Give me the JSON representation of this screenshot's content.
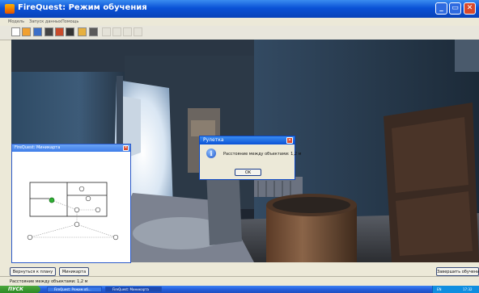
{
  "window": {
    "title": "FireQuest: Режим обучения",
    "minimize_symbol": "_",
    "maximize_symbol": "▭",
    "close_symbol": "✕"
  },
  "menu": {
    "items": [
      {
        "label": "Модель"
      },
      {
        "label": "Запуск данных"
      },
      {
        "label": "Помощь"
      }
    ]
  },
  "toolbar": {
    "tools": [
      {
        "icon": "select-tool-icon",
        "enabled": true
      },
      {
        "icon": "hand-tool-icon",
        "enabled": true
      },
      {
        "icon": "helmet-tool-icon",
        "enabled": true
      },
      {
        "icon": "camera-tool-icon",
        "enabled": true
      },
      {
        "icon": "fire-tool-icon",
        "enabled": true
      },
      {
        "icon": "ruler-tool-icon",
        "enabled": true
      },
      {
        "icon": "pencil-tool-icon",
        "enabled": true
      },
      {
        "icon": "monitor-tool-icon",
        "enabled": true
      },
      {
        "icon": "disabled-tool-icon",
        "enabled": false
      },
      {
        "icon": "disabled-tool-icon",
        "enabled": false
      },
      {
        "icon": "disabled-tool-icon",
        "enabled": false
      },
      {
        "icon": "disabled-tool-icon",
        "enabled": false
      }
    ]
  },
  "minimap": {
    "title": "FireQuest: Миникарта",
    "close_symbol": "✕"
  },
  "dialog": {
    "title": "Рулетка",
    "message": "Расстояние между объектами: 1,2 м",
    "ok_label": "OK",
    "close_symbol": "✕",
    "icon_glyph": "i"
  },
  "bottom_buttons": {
    "back_to_plan": "Вернуться к плану",
    "minimap": "Миникарта",
    "finish_training": "Завершить обучение"
  },
  "status": {
    "text": "Расстояние между объектами: 1,2 м"
  },
  "taskbar": {
    "start_label": "ПУСК",
    "items": [
      {
        "label": "FireQuest: Режим об..."
      },
      {
        "label": "FireQuest: Миникарта"
      }
    ],
    "tray_lang": "EN",
    "clock": "17:32"
  },
  "colors": {
    "xp_blue": "#0a52d6",
    "start_green": "#3a9a2e",
    "close_red": "#d8492b"
  }
}
